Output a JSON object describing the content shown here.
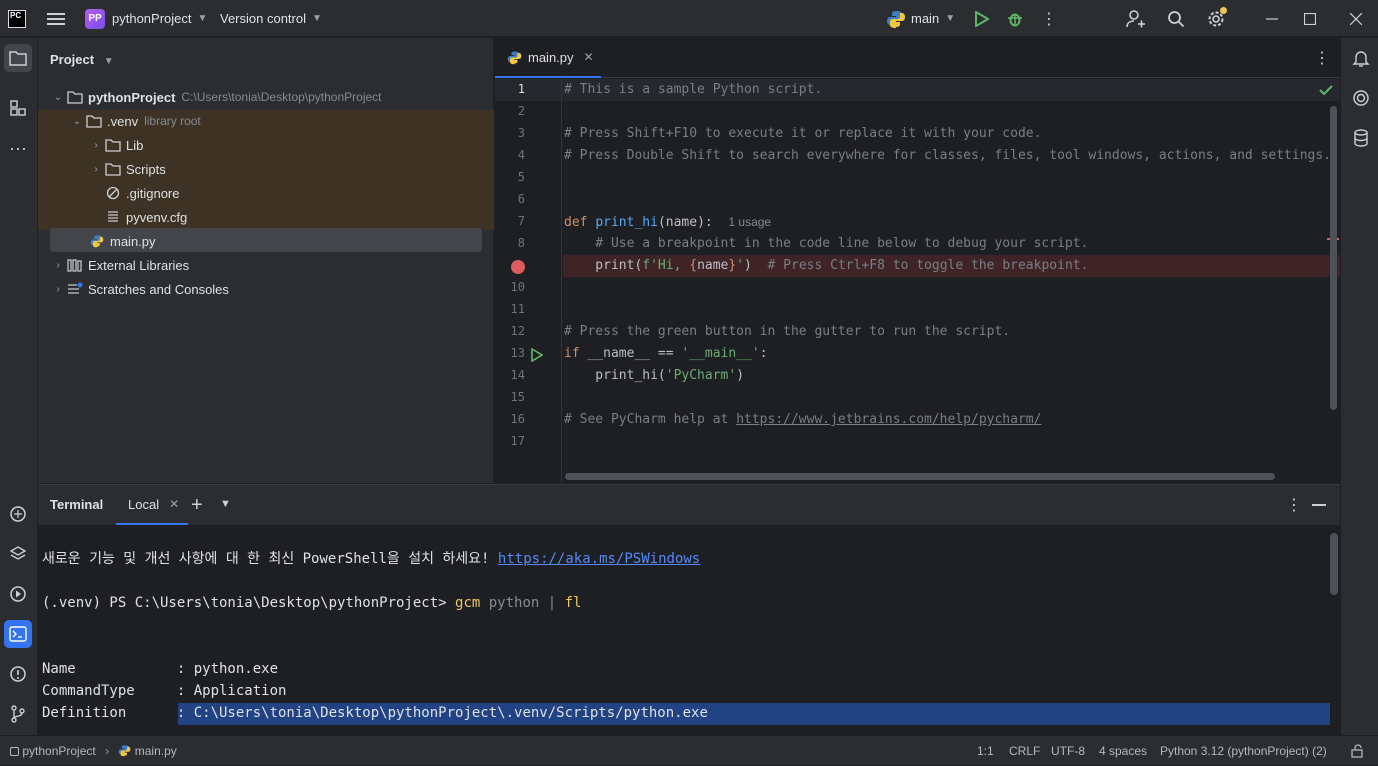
{
  "titlebar": {
    "logo_text": "PC",
    "project_badge": "PP",
    "project_name": "pythonProject",
    "vcs_label": "Version control",
    "run_config": "main"
  },
  "project_panel": {
    "title": "Project",
    "tree": [
      {
        "label": "pythonProject",
        "hint": "C:\\Users\\tonia\\Desktop\\pythonProject"
      },
      {
        "label": ".venv",
        "hint": "library root"
      },
      {
        "label": "Lib"
      },
      {
        "label": "Scripts"
      },
      {
        "label": ".gitignore"
      },
      {
        "label": "pyvenv.cfg"
      },
      {
        "label": "main.py"
      },
      {
        "label": "External Libraries"
      },
      {
        "label": "Scratches and Consoles"
      }
    ]
  },
  "editor": {
    "tab_label": "main.py",
    "line_numbers": [
      "1",
      "2",
      "3",
      "4",
      "5",
      "6",
      "7",
      "8",
      "9",
      "10",
      "11",
      "12",
      "13",
      "14",
      "15",
      "16",
      "17"
    ],
    "lines": {
      "l1": "# This is a sample Python script.",
      "l3": "# Press Shift+F10 to execute it or replace it with your code.",
      "l4": "# Press Double Shift to search everywhere for classes, files, tool windows, actions, and settings.",
      "l7_kw": "def ",
      "l7_fn": "print_hi",
      "l7_rest": "(name):",
      "l7_hint": "1 usage",
      "l8": "    # Use a breakpoint in the code line below to debug your script.",
      "l9_a": "    print(",
      "l9_s1": "f'Hi, ",
      "l9_b1": "{",
      "l9_nm": "name",
      "l9_b2": "}",
      "l9_s2": "'",
      "l9_c": ")  ",
      "l9_cm": "# Press Ctrl+F8 to toggle the breakpoint.",
      "l12": "# Press the green button in the gutter to run the script.",
      "l13_kw": "if ",
      "l13_a": "__name__ == ",
      "l13_s": "'__main__'",
      "l13_c": ":",
      "l14_a": "    print_hi(",
      "l14_s": "'PyCharm'",
      "l14_c": ")",
      "l16_cm": "# See PyCharm help at ",
      "l16_link": "https://www.jetbrains.com/help/pycharm/"
    }
  },
  "terminal": {
    "title": "Terminal",
    "tab_label": "Local",
    "line1_text": "새로운 기능 및 개선 사항에 대 한 최신 PowerShell을 설치 하세요! ",
    "line1_link": "https://aka.ms/PSWindows",
    "prompt": "(.venv) PS C:\\Users\\tonia\\Desktop\\pythonProject> ",
    "cmd_gcm": "gcm",
    "cmd_arg": " python | ",
    "cmd_fl": "fl",
    "out_name": "Name            : python.exe",
    "out_type": "CommandType     : Application",
    "out_def_label": "Definition      : ",
    "out_def_value": "C:\\Users\\tonia\\Desktop\\pythonProject\\.venv/Scripts/python.exe"
  },
  "statusbar": {
    "crumb_project": "pythonProject",
    "crumb_file": "main.py",
    "position": "1:1",
    "line_sep": "CRLF",
    "encoding": "UTF-8",
    "indent": "4 spaces",
    "interpreter": "Python 3.12 (pythonProject) (2)"
  },
  "colors": {
    "accent": "#3574f0",
    "breakpoint": "#db5c5c",
    "run_green": "#5fb865",
    "library_bg": "#3d3223"
  }
}
